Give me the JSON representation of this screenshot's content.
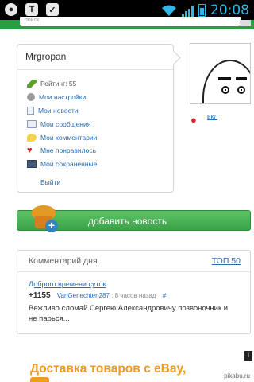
{
  "status_bar": {
    "time": "20:08",
    "left_icons": [
      "notification-icon",
      "text-app-icon",
      "checkmark-icon"
    ]
  },
  "search": {
    "placeholder": "поиск..."
  },
  "user_panel": {
    "username": "Mrgropan",
    "rating_label": "Рейтинг: 55",
    "menu": [
      {
        "label": "Мои настройки",
        "icon": "gear-icon"
      },
      {
        "label": "Мои новости",
        "icon": "document-icon"
      },
      {
        "label": "Мои сообщения",
        "icon": "envelope-icon"
      },
      {
        "label": "Мои комментарии",
        "icon": "speech-bubble-icon"
      },
      {
        "label": "Мне понравилось",
        "icon": "heart-icon"
      },
      {
        "label": "Мои сохранённые",
        "icon": "floppy-disk-icon"
      }
    ],
    "logout": "Выйти"
  },
  "strawberry_toggle": {
    "label": "вкл"
  },
  "add_news": {
    "label": "добавить новость"
  },
  "comment_of_day": {
    "title": "Комментарий дня",
    "top_link": "ТОП 50",
    "post_title": "Доброго времени суток",
    "score": "+1155",
    "author": "VanGenechten287",
    "time_ago": "; 8 часов назад",
    "permalink": "#",
    "text": "Вежливо сломай Сергею Александровичу позвоночник и не парься..."
  },
  "ad": {
    "text": "Доставка товаров с eBay,"
  },
  "watermark": "pikabu.ru",
  "colors": {
    "link": "#2a6eb5",
    "green": "#3aa247",
    "status_accent": "#33b5e5",
    "ad_orange": "#f29a1f"
  }
}
